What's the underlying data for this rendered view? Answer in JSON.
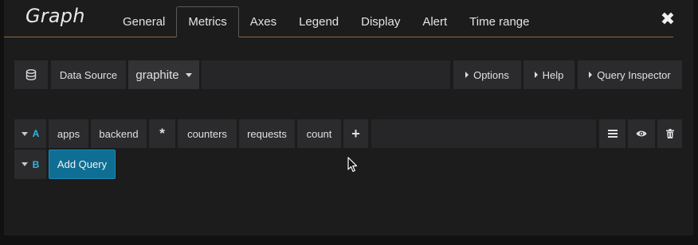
{
  "panel": {
    "title": "Graph"
  },
  "tabs": [
    {
      "label": "General"
    },
    {
      "label": "Metrics",
      "active": true
    },
    {
      "label": "Axes"
    },
    {
      "label": "Legend"
    },
    {
      "label": "Display"
    },
    {
      "label": "Alert"
    },
    {
      "label": "Time range"
    }
  ],
  "close_label": "✖",
  "datasource_row": {
    "icon": "database-icon",
    "label": "Data Source",
    "value": "graphite",
    "options_label": "Options",
    "help_label": "Help",
    "inspector_label": "Query Inspector"
  },
  "query_a": {
    "ref_id": "A",
    "segments": [
      "apps",
      "backend",
      "*",
      "counters",
      "requests",
      "count"
    ],
    "add_segment": "+"
  },
  "query_b": {
    "ref_id": "B"
  },
  "add_query_label": "Add Query",
  "colors": {
    "accent_blue": "#33b5e5",
    "button_blue": "#0f6e94",
    "header_line": "#8a6a3a"
  }
}
